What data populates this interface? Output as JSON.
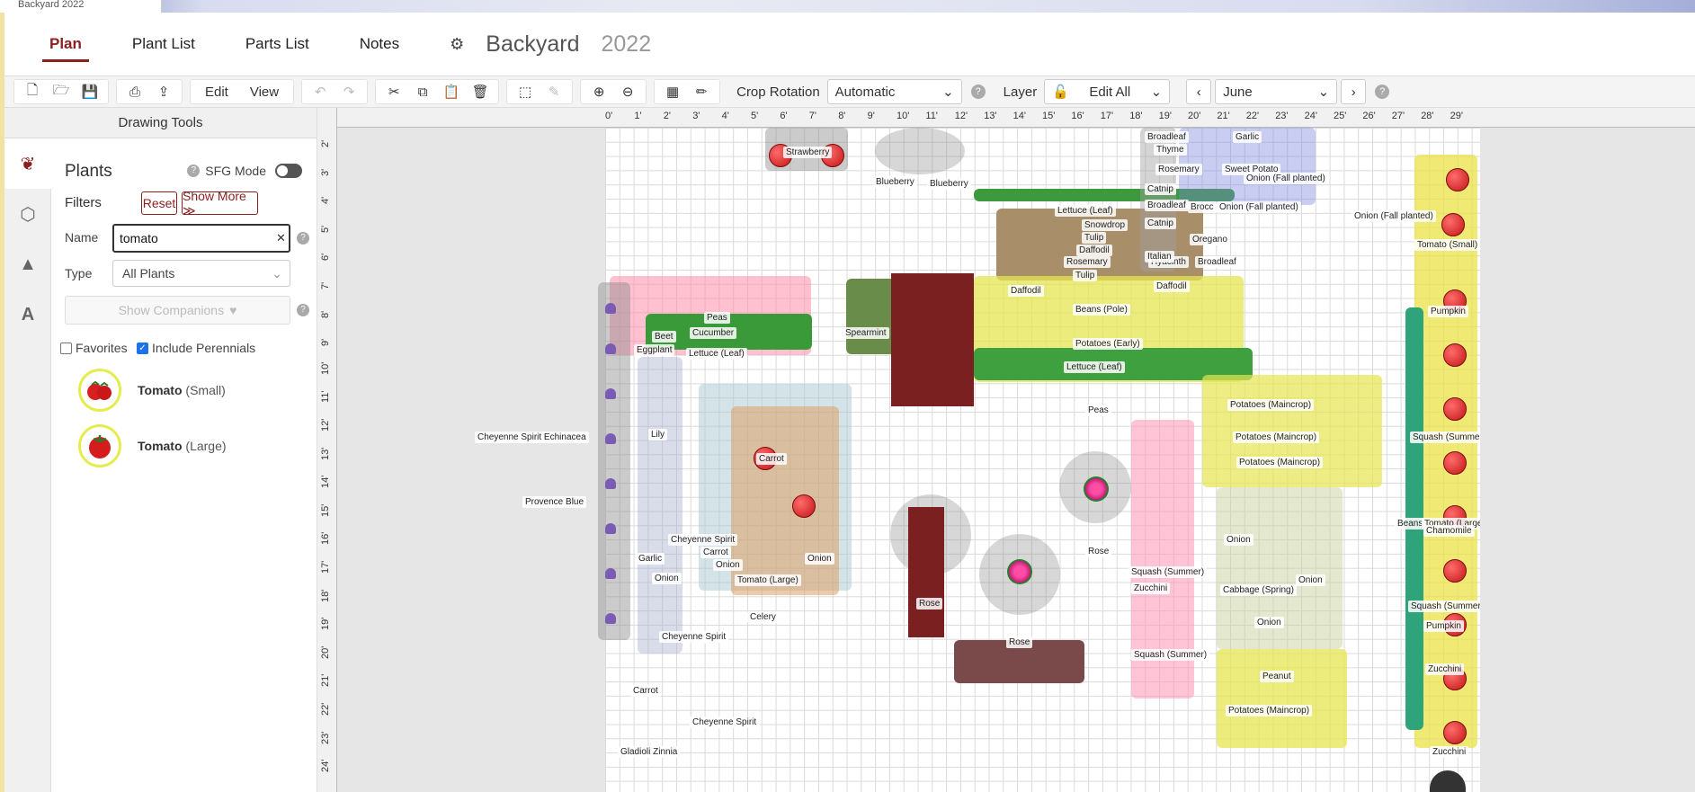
{
  "window": {
    "tab_fragment": "Backyard 2022"
  },
  "nav": {
    "tabs": [
      {
        "label": "Plan",
        "active": true
      },
      {
        "label": "Plant List",
        "active": false
      },
      {
        "label": "Parts List",
        "active": false
      },
      {
        "label": "Notes",
        "active": false
      }
    ],
    "settings_icon": "gear-icon",
    "plan_name": "Backyard",
    "plan_year": "2022"
  },
  "toolbar": {
    "edit_label": "Edit",
    "view_label": "View",
    "crop_rotation_label": "Crop Rotation",
    "crop_rotation_value": "Automatic",
    "layer_label": "Layer",
    "layer_value": "Edit All",
    "month_value": "June"
  },
  "sidebar": {
    "title": "Drawing Tools",
    "panel_title": "Plants",
    "sfg_label": "SFG Mode",
    "sfg_on": false,
    "filters_label": "Filters",
    "reset_label": "Reset",
    "show_more_label": "Show More ≫",
    "name_label": "Name",
    "name_value": "tomato",
    "type_label": "Type",
    "type_value": "All Plants",
    "show_companions_label": "Show Companions",
    "favorites_label": "Favorites",
    "favorites_checked": false,
    "include_perennials_label": "Include Perennials",
    "include_perennials_checked": true,
    "results": [
      {
        "name": "Tomato",
        "variety": "(Small)"
      },
      {
        "name": "Tomato",
        "variety": "(Large)"
      }
    ]
  },
  "rulers": {
    "horizontal": [
      "0'",
      "1'",
      "2'",
      "3'",
      "4'",
      "5'",
      "6'",
      "7'",
      "8'",
      "9'",
      "10'",
      "11'",
      "12'",
      "13'",
      "14'",
      "15'",
      "16'",
      "17'",
      "18'",
      "19'",
      "20'",
      "21'",
      "22'",
      "23'",
      "24'",
      "25'",
      "26'",
      "27'",
      "28'",
      "29'"
    ],
    "vertical": [
      "2'",
      "3'",
      "4'",
      "5'",
      "6'",
      "7'",
      "8'",
      "9'",
      "10'",
      "11'",
      "12'",
      "13'",
      "14'",
      "15'",
      "16'",
      "17'",
      "18'",
      "19'",
      "20'",
      "21'",
      "22'",
      "23'",
      "24'"
    ]
  },
  "garden_labels": {
    "strawberry": "Strawberry",
    "blueberry1": "Blueberry",
    "blueberry2": "Blueberry",
    "peas": "Peas",
    "beet": "Beet",
    "cucumber": "Cucumber",
    "eggplant": "Eggplant",
    "lettuce_leaf1": "Lettuce (Leaf)",
    "spearmint": "Spearmint",
    "cheyenne_echinacea": "Cheyenne Spirit Echinacea",
    "provence_blue": "Provence Blue",
    "lily": "Lily",
    "carrot1": "Carrot",
    "cheyenne1": "Cheyenne Spirit",
    "carrot2": "Carrot",
    "onion1": "Onion",
    "onion2": "Onion",
    "garlic1": "Garlic",
    "onion3": "Onion",
    "tomato_large": "Tomato (Large)",
    "celery": "Celery",
    "cheyenne2": "Cheyenne Spirit",
    "carrot3": "Carrot",
    "cheyenne3": "Cheyenne Spirit",
    "gladioli_zinnia": "Gladioli Zinnia",
    "rose1": "Rose",
    "rose2": "Rose",
    "rose3": "Rose",
    "daffodil1": "Daffodil",
    "daffodil2": "Daffodil",
    "daffodil3": "Daffodil",
    "snowdrop": "Snowdrop",
    "tulip1": "Tulip",
    "tulip2": "Tulip",
    "rosemary1": "Rosemary",
    "hyacinth": "Hyacinth",
    "lettuce_leaf2": "Lettuce (Leaf)",
    "beans_pole": "Beans (Pole)",
    "potatoes_early": "Potatoes (Early)",
    "lettuce_leaf3": "Lettuce (Leaf)",
    "peas2": "Peas",
    "broadleaf1": "Broadleaf",
    "thyme": "Thyme",
    "rosemary2": "Rosemary",
    "catnip1": "Catnip",
    "broadleaf2": "Broadleaf",
    "catnip2": "Catnip",
    "oregano": "Oregano",
    "italian": "Italian",
    "broadleaf3": "Broadleaf",
    "garlic2": "Garlic",
    "sweet_potato": "Sweet Potato",
    "onion_fall1": "Onion (Fall planted)",
    "brocc": "Brocc",
    "onion_fall2": "Onion (Fall planted)",
    "onion_fall3": "Onion (Fall planted)",
    "tomato_small": "Tomato (Small)",
    "pumpkin1": "Pumpkin",
    "potatoes_main1": "Potatoes (Maincrop)",
    "potatoes_main2": "Potatoes (Maincrop)",
    "potatoes_main3": "Potatoes (Maincrop)",
    "squash_summer1": "Squash (Summer)",
    "beans": "Beans",
    "tomato_large2": "Tomato (Large)",
    "chamomile": "Chamomile",
    "squash_summer2": "Squash (Summer)",
    "zucchini1": "Zucchini",
    "onion4": "Onion",
    "onion5": "Onion",
    "cabbage": "Cabbage (Spring)",
    "onion6": "Onion",
    "squash_summer3": "Squash (Summer)",
    "pumpkin2": "Pumpkin",
    "squash_summer4": "Squash (Summer)",
    "zucchini2": "Zucchini",
    "peanut": "Peanut",
    "potatoes_main4": "Potatoes (Maincrop)",
    "zucchini3": "Zucchini"
  },
  "colors": {
    "brand": "#8b2020",
    "toggle": "#555555"
  }
}
